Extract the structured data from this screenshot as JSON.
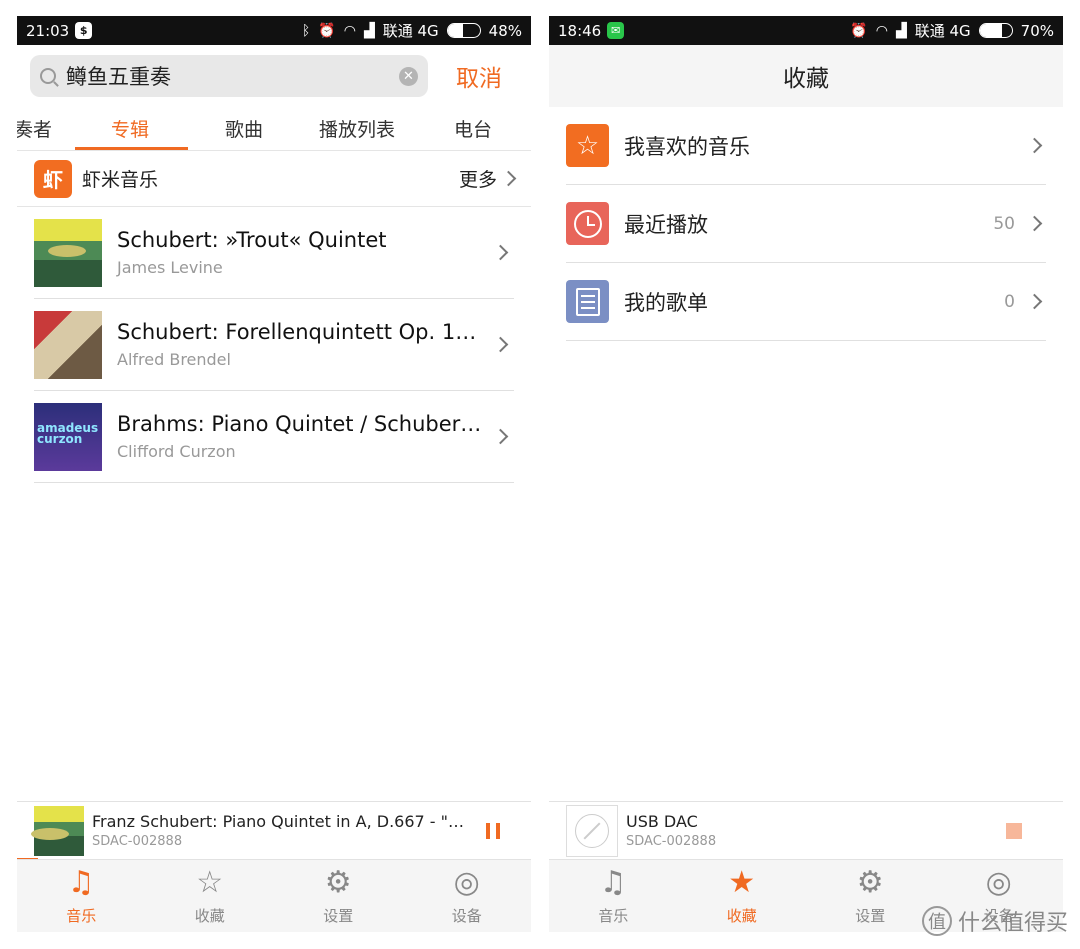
{
  "left": {
    "status": {
      "time": "21:03",
      "app_icon": "$",
      "carrier": "联通 4G",
      "battery": "48%",
      "battery_level": 0.48
    },
    "search": {
      "query": "鳟鱼五重奏",
      "cancel_label": "取消"
    },
    "tabs": [
      "演奏者",
      "专辑",
      "歌曲",
      "播放列表",
      "电台"
    ],
    "active_tab": "专辑",
    "source": {
      "logo": "虾",
      "name": "虾米音乐",
      "more_label": "更多"
    },
    "albums": [
      {
        "title": "Schubert: »Trout« Quintet",
        "artist": "James Levine"
      },
      {
        "title": "Schubert: Forellenquintett Op. 114...",
        "artist": "Alfred Brendel"
      },
      {
        "title": "Brahms: Piano Quintet / Schubert...",
        "artist": "Clifford Curzon",
        "cover_text": "amadeus curzon"
      }
    ],
    "now_playing": {
      "title": "Franz Schubert: Piano Quintet in A, D.667 - \"The ...",
      "device": "SDAC-002888",
      "progress": 0.04
    },
    "nav": [
      {
        "label": "音乐",
        "icon": "♫"
      },
      {
        "label": "收藏",
        "icon": "☆"
      },
      {
        "label": "设置",
        "icon": "⚙"
      },
      {
        "label": "设备",
        "icon": "◎"
      }
    ],
    "active_nav": "音乐"
  },
  "right": {
    "status": {
      "time": "18:46",
      "app_icon": "✉",
      "carrier": "联通 4G",
      "battery": "70%",
      "battery_level": 0.7
    },
    "header_title": "收藏",
    "favorites": [
      {
        "label": "我喜欢的音乐",
        "count": "",
        "icon": "star-icon",
        "color": "#f26d21"
      },
      {
        "label": "最近播放",
        "count": "50",
        "icon": "clock-icon",
        "color": "#e8655a"
      },
      {
        "label": "我的歌单",
        "count": "0",
        "icon": "list-icon",
        "color": "#7b8fc4"
      }
    ],
    "now_playing": {
      "title": "USB DAC",
      "device": "SDAC-002888"
    },
    "nav": [
      {
        "label": "音乐",
        "icon": "♫"
      },
      {
        "label": "收藏",
        "icon": "★"
      },
      {
        "label": "设置",
        "icon": "⚙"
      },
      {
        "label": "设备",
        "icon": "◎"
      }
    ],
    "active_nav": "收藏"
  },
  "watermark": {
    "badge": "值",
    "text": "什么值得买"
  },
  "colors": {
    "accent": "#f06a22"
  }
}
